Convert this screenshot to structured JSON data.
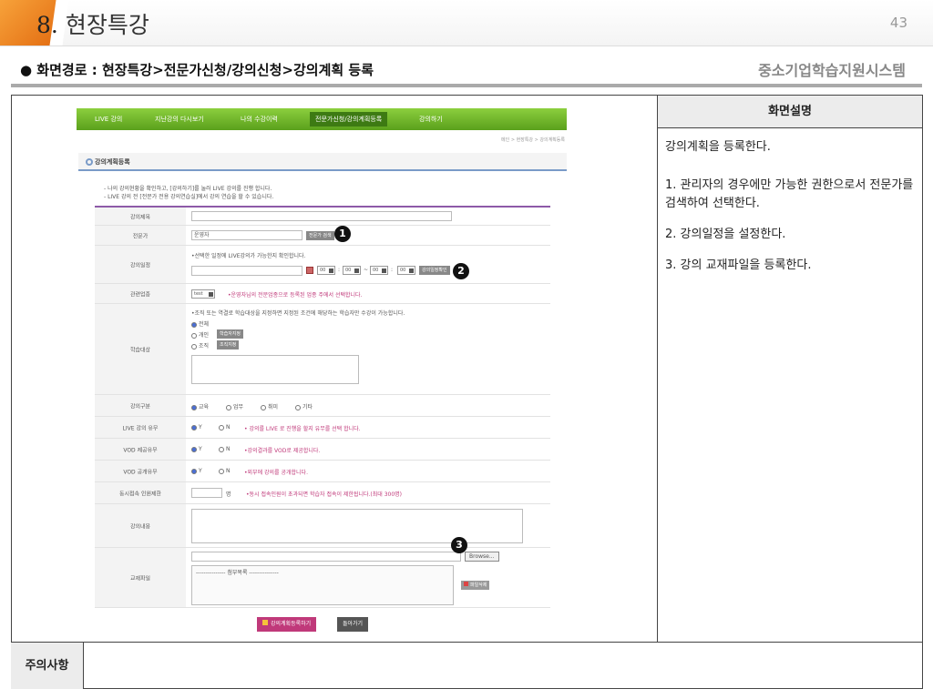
{
  "header": {
    "number": "8.",
    "title": "현장특강",
    "page": "43"
  },
  "route": "● 화면경로 : 현장특강>전문가신청/강의신청>강의계획 등록",
  "system_name": "중소기업학습지원시스템",
  "desc": {
    "header": "화면설명",
    "lines": [
      "강의계획을 등록한다.",
      "1. 관리자의 경우에만 가능한 권한으로서 전문가를 검색하여 선택한다.",
      "2. 강의일정을 설정한다.",
      "3. 강의 교재파일을 등록한다."
    ]
  },
  "note_label": "주의사항",
  "site": {
    "nav": [
      "LIVE 강의",
      "지난강의 다시보기",
      "나의 수강이력",
      "전문가신청/강의계획등록",
      "강의하기"
    ],
    "breadcrumb": "메인 > 현장특강 > 강의계획등록",
    "page_title": "강의계획등록",
    "notice1": "- 나의 강의현황을 확인하고, [강의하기]를 눌러 LIVE 강의를 진행 합니다.",
    "notice2": "- LIVE 강의 전 [전문가 전용 강의연습실]에서 강의 연습을 할 수 있습니다.",
    "form": {
      "title_label": "강의제목",
      "expert_label": "전문가",
      "expert_value": "운영자",
      "expert_btn": "전문가 검색",
      "schedule_label": "강의일정",
      "schedule_hint": "•선택한 일정에 LIVE강의가 가능한지 확인합니다.",
      "time_val": "00",
      "schedule_btn": "강의일정확인",
      "industry_label": "관련업종",
      "industry_value": "test",
      "industry_hint": "•운영자님의 전문업종으로 등록된 업종 주에서 선택합니다.",
      "target_label": "학습대상",
      "target_hint": "•조직 또는 역결로 학습대상을 지정하면 지정된 조건에 해당하는 학습자만 수강이 가능합니다.",
      "target_all": "전체",
      "target_person": "개인",
      "target_person_btn": "학습자지정",
      "target_org": "조직",
      "target_org_btn": "조직지정",
      "category_label": "강의구분",
      "cat_opts": [
        "교육",
        "업무",
        "취미",
        "기타"
      ],
      "live_label": "LIVE 강의 유무",
      "live_hint": "• 강의를 LIVE 로 진행을 할지 유무를 선택 합니다.",
      "vod_label": "VOD 제공유무",
      "vod_hint": "•강의결과를 VOD로 제공합니다.",
      "vodpub_label": "VOD 공개유무",
      "vodpub_hint": "•외부에 강의를 공개합니다.",
      "yes": "Y",
      "no": "N",
      "limit_label": "동시접속 인원제한",
      "limit_unit": "명",
      "limit_hint": "•동시 접속인원이 초과되면 학습자 접속이 제한됩니다.(최대 300명)",
      "content_label": "강의내용",
      "file_label": "교재파일",
      "browse_btn": "Browse...",
      "file_list_head": "--------------- 첨부목록 ---------------",
      "file_del_btn": "파일삭제"
    },
    "submit_btn": "강의계획등록하기",
    "back_btn": "돌아가기"
  },
  "markers": [
    "1",
    "2",
    "3"
  ],
  "colors": {
    "accent_orange": "#e36d12",
    "nav_green": "#6bb02a",
    "form_purple": "#8d5aa8",
    "pink_text": "#c0397a"
  }
}
